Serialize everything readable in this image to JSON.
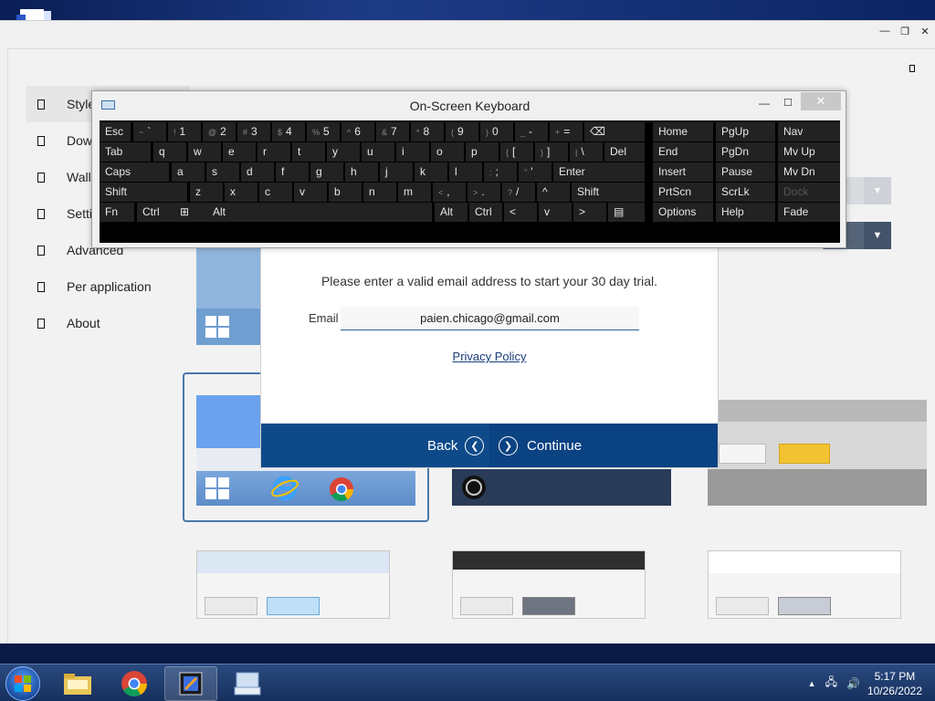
{
  "sidebar": {
    "items": [
      {
        "label": "Style",
        "active": true
      },
      {
        "label": "Dow"
      },
      {
        "label": "Wallp"
      },
      {
        "label": "Setti"
      },
      {
        "label": "Advanced"
      },
      {
        "label": "Per application"
      },
      {
        "label": "About"
      }
    ]
  },
  "dialog": {
    "message": "Please enter a valid email address to start your 30 day trial.",
    "email_label": "Email",
    "email_value": "paien.chicago@gmail.com",
    "privacy_link": "Privacy Policy",
    "back_label": "Back",
    "continue_label": "Continue"
  },
  "keyboard": {
    "title": "On-Screen Keyboard",
    "rows": {
      "r1": [
        "Esc",
        "~ `",
        "! 1",
        "@ 2",
        "# 3",
        "$ 4",
        "% 5",
        "^ 6",
        "& 7",
        "* 8",
        "( 9",
        ") 0",
        "_ -",
        "+ =",
        "⌫"
      ],
      "r2": [
        "Tab",
        "q",
        "w",
        "e",
        "r",
        "t",
        "y",
        "u",
        "i",
        "o",
        "p",
        "{ [",
        "} ]",
        "| \\",
        "Del"
      ],
      "r3": [
        "Caps",
        "a",
        "s",
        "d",
        "f",
        "g",
        "h",
        "j",
        "k",
        "l",
        ": ;",
        "\" '",
        "Enter"
      ],
      "r4": [
        "Shift",
        "z",
        "x",
        "c",
        "v",
        "b",
        "n",
        "m",
        "< ,",
        "> .",
        "? /",
        "^",
        "Shift"
      ],
      "r5": [
        "Fn",
        "Ctrl",
        "⊞",
        "Alt",
        "",
        "Alt",
        "Ctrl",
        "<",
        "v",
        ">",
        "▤"
      ]
    },
    "nav": [
      [
        "Home",
        "PgUp",
        "Nav"
      ],
      [
        "End",
        "PgDn",
        "Mv Up"
      ],
      [
        "Insert",
        "Pause",
        "Mv Dn"
      ],
      [
        "PrtScn",
        "ScrLk",
        "Dock"
      ],
      [
        "Options",
        "Help",
        "Fade"
      ]
    ]
  },
  "taskbar": {
    "time": "5:17 PM",
    "date": "10/26/2022"
  },
  "colors": {
    "dialog_footer": "#0e4a8a",
    "accent_frame": "#4a78a8",
    "taskbar": "#16305e"
  }
}
